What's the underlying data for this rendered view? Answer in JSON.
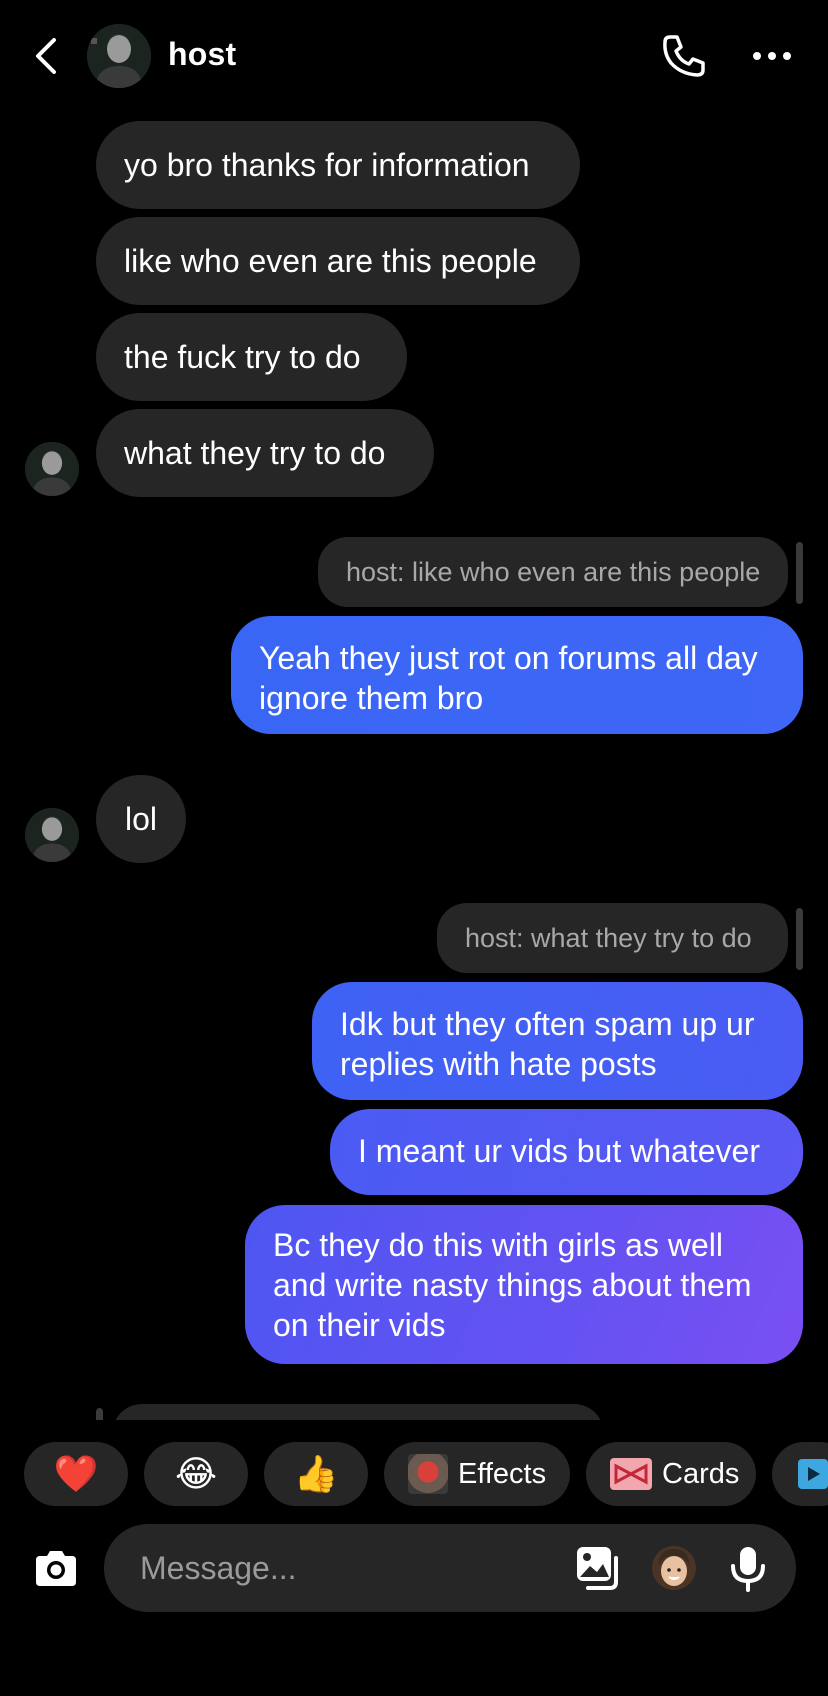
{
  "header": {
    "contact_name": "host",
    "icons": {
      "back": "chevron-left-icon",
      "call": "phone-icon",
      "more": "more-horizontal-icon"
    }
  },
  "received_1": [
    "yo bro thanks for information",
    "like who even are this people",
    "the fuck try to do",
    "what they try to do"
  ],
  "reply_1": {
    "preview": "host: like who even are this people",
    "line1": "Yeah they just rot on forums all day",
    "line2": "ignore them bro"
  },
  "received_2": "lol",
  "reply_2": {
    "preview": "host: what they try to do",
    "msg1_line1": "Idk but they often spam up ur",
    "msg1_line2": "replies with hate posts",
    "msg2": "I meant ur vids but whatever",
    "msg3_line1": "Bc they do this with girls as well",
    "msg3_line2": "and write nasty things about them",
    "msg3_line3": "on their vids"
  },
  "quick_actions": {
    "heart": "❤️",
    "laugh": "😂",
    "thumbs": "👍",
    "effects": "Effects",
    "cards": "Cards"
  },
  "composer": {
    "placeholder": "Message...",
    "icons": {
      "camera": "camera-icon",
      "gallery": "gallery-icon",
      "avatar": "avatar-sticker-icon",
      "mic": "microphone-icon"
    }
  },
  "colors": {
    "background": "#000000",
    "received_bubble": "#262626",
    "sent_gradient_start": "#3a66f5",
    "sent_gradient_end": "#7a4ff2",
    "secondary_text": "#a8a8a8"
  }
}
